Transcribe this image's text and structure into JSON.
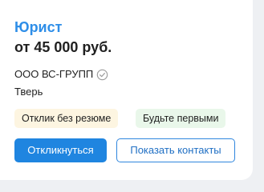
{
  "vacancy": {
    "title": "Юрист",
    "salary": "от 45 000 руб.",
    "company": "ООО ВС-ГРУПП",
    "city": "Тверь",
    "verified_icon": "check-circle-icon"
  },
  "tags": [
    {
      "label": "Отклик без резюме",
      "color": "#fdf5e1"
    },
    {
      "label": "Будьте первыми",
      "color": "#e9f7ea"
    }
  ],
  "actions": {
    "respond_label": "Откликнуться",
    "show_contacts_label": "Показать контакты"
  },
  "colors": {
    "title": "#2e8ee8",
    "primary_button": "#1f85e0",
    "secondary_button_text": "#1f6fc4"
  }
}
